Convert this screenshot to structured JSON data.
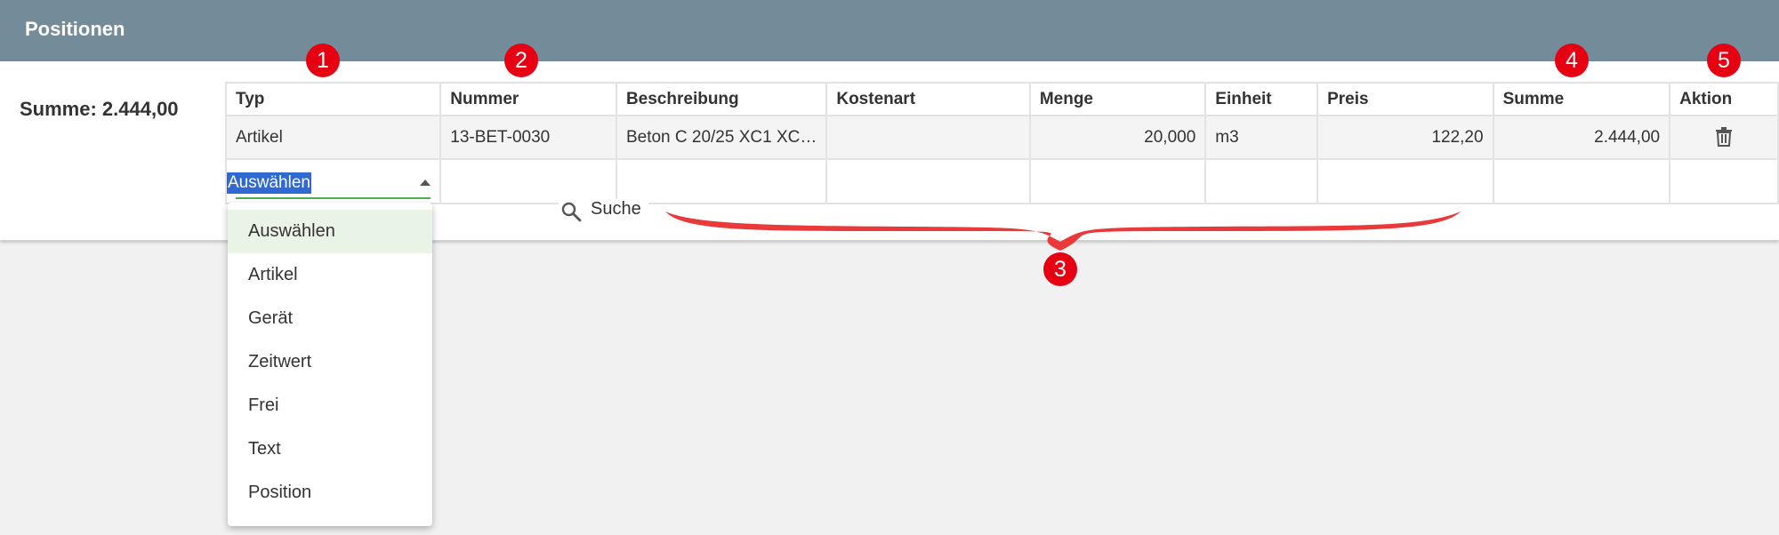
{
  "panel": {
    "title": "Positionen"
  },
  "summary": {
    "total_label": "Summe: 2.444,00"
  },
  "table": {
    "headers": [
      "Typ",
      "Nummer",
      "Beschreibung",
      "Kostenart",
      "Menge",
      "Einheit",
      "Preis",
      "Summe",
      "Aktion"
    ],
    "rows": [
      {
        "typ": "Artikel",
        "nummer": "13-BET-0030",
        "beschreibung": "Beton C 20/25 XC1 XC…",
        "kostenart": "",
        "menge": "20,000",
        "einheit": "m3",
        "preis": "122,20",
        "summe": "2.444,00",
        "aktion_icon": "trash-icon"
      }
    ],
    "new_row": {
      "typ_select_value": "Auswählen"
    }
  },
  "dropdown": {
    "options": [
      "Auswählen",
      "Artikel",
      "Gerät",
      "Zeitwert",
      "Frei",
      "Text",
      "Position"
    ],
    "selected": "Auswählen"
  },
  "search": {
    "label": "Suche",
    "icon": "search-icon"
  },
  "callouts": [
    "1",
    "2",
    "3",
    "4",
    "5"
  ],
  "colors": {
    "header_bg": "#748b99",
    "callout": "#e60012",
    "select_underline": "#4caf50",
    "selection_bg": "#3069d2"
  }
}
